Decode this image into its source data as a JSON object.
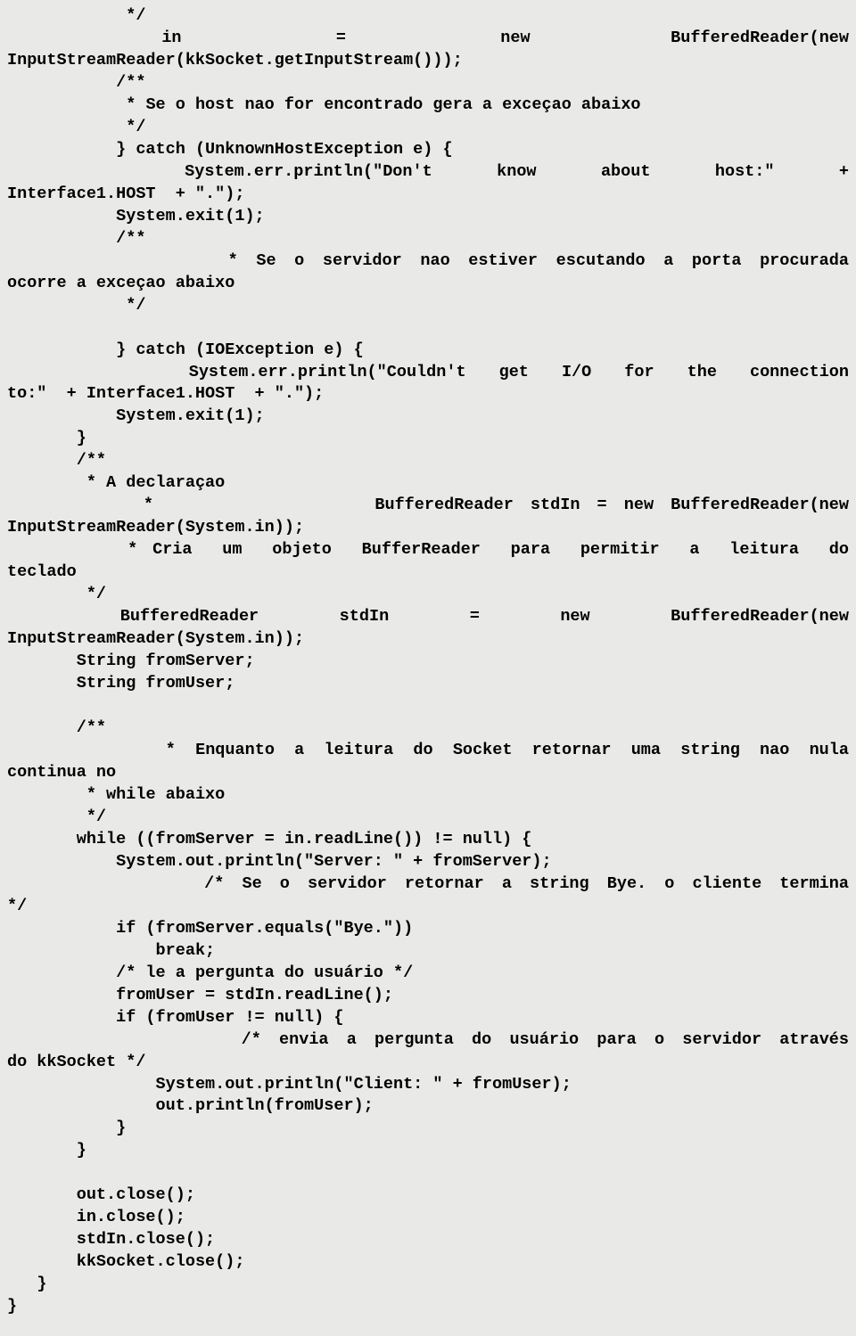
{
  "lines": [
    {
      "j": false,
      "t": "            */"
    },
    {
      "j": true,
      "t": "           in           =           new          BufferedReader(new"
    },
    {
      "j": false,
      "t": "InputStreamReader(kkSocket.getInputStream()));"
    },
    {
      "j": false,
      "t": "           /**"
    },
    {
      "j": false,
      "t": "            * Se o host nao for encontrado gera a exceçao abaixo"
    },
    {
      "j": false,
      "t": "            */"
    },
    {
      "j": false,
      "t": "           } catch (UnknownHostException e) {"
    },
    {
      "j": true,
      "t": "           System.err.println(\"Don't    know    about    host:\"    +"
    },
    {
      "j": false,
      "t": "Interface1.HOST  + \".\");"
    },
    {
      "j": false,
      "t": "           System.exit(1);"
    },
    {
      "j": false,
      "t": "           /**"
    },
    {
      "j": true,
      "t": "            * Se o servidor nao estiver escutando a porta procurada"
    },
    {
      "j": false,
      "t": "ocorre a exceçao abaixo"
    },
    {
      "j": false,
      "t": "            */"
    },
    {
      "j": false,
      "t": ""
    },
    {
      "j": false,
      "t": "           } catch (IOException e) {"
    },
    {
      "j": true,
      "t": "           System.err.println(\"Couldn't  get  I/O  for  the  connection"
    },
    {
      "j": false,
      "t": "to:\"  + Interface1.HOST  + \".\");"
    },
    {
      "j": false,
      "t": "           System.exit(1);"
    },
    {
      "j": false,
      "t": "       }"
    },
    {
      "j": false,
      "t": "       /**"
    },
    {
      "j": false,
      "t": "        * A declaraçao"
    },
    {
      "j": true,
      "t": "        *             BufferedReader stdIn = new BufferedReader(new"
    },
    {
      "j": false,
      "t": "InputStreamReader(System.in));"
    },
    {
      "j": true,
      "t": "        * Cria  um  objeto  BufferReader  para  permitir  a  leitura  do"
    },
    {
      "j": false,
      "t": "teclado"
    },
    {
      "j": false,
      "t": "        */"
    },
    {
      "j": true,
      "t": "       BufferedReader     stdIn     =     new     BufferedReader(new"
    },
    {
      "j": false,
      "t": "InputStreamReader(System.in));"
    },
    {
      "j": false,
      "t": "       String fromServer;"
    },
    {
      "j": false,
      "t": "       String fromUser;"
    },
    {
      "j": false,
      "t": ""
    },
    {
      "j": false,
      "t": "       /**"
    },
    {
      "j": true,
      "t": "        * Enquanto a leitura do Socket retornar uma string nao nula"
    },
    {
      "j": false,
      "t": "continua no"
    },
    {
      "j": false,
      "t": "        * while abaixo"
    },
    {
      "j": false,
      "t": "        */"
    },
    {
      "j": false,
      "t": "       while ((fromServer = in.readLine()) != null) {"
    },
    {
      "j": false,
      "t": "           System.out.println(\"Server: \" + fromServer);"
    },
    {
      "j": true,
      "t": "           /* Se o servidor retornar a string Bye. o cliente termina"
    },
    {
      "j": false,
      "t": "*/"
    },
    {
      "j": false,
      "t": "           if (fromServer.equals(\"Bye.\"))"
    },
    {
      "j": false,
      "t": "               break;"
    },
    {
      "j": false,
      "t": "           /* le a pergunta do usuário */"
    },
    {
      "j": false,
      "t": "           fromUser = stdIn.readLine();"
    },
    {
      "j": false,
      "t": "           if (fromUser != null) {"
    },
    {
      "j": true,
      "t": "             /* envia a pergunta do usuário para o servidor através"
    },
    {
      "j": false,
      "t": "do kkSocket */"
    },
    {
      "j": false,
      "t": "               System.out.println(\"Client: \" + fromUser);"
    },
    {
      "j": false,
      "t": "               out.println(fromUser);"
    },
    {
      "j": false,
      "t": "           }"
    },
    {
      "j": false,
      "t": "       }"
    },
    {
      "j": false,
      "t": ""
    },
    {
      "j": false,
      "t": "       out.close();"
    },
    {
      "j": false,
      "t": "       in.close();"
    },
    {
      "j": false,
      "t": "       stdIn.close();"
    },
    {
      "j": false,
      "t": "       kkSocket.close();"
    },
    {
      "j": false,
      "t": "   }"
    },
    {
      "j": false,
      "t": "}"
    }
  ]
}
